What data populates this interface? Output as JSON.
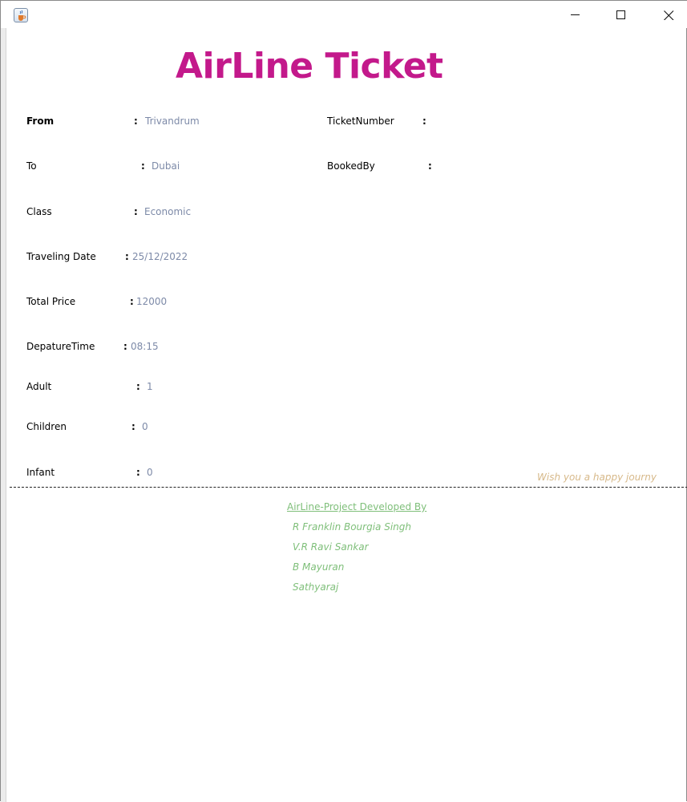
{
  "window": {
    "controls": {
      "minimize_icon": "minimize-icon",
      "maximize_icon": "maximize-icon",
      "close_icon": "close-icon"
    },
    "app_icon": "java-cup-icon"
  },
  "ticket": {
    "title": "AirLine Ticket",
    "colon": ":",
    "fields": {
      "from": {
        "label": "From",
        "value": "Trivandrum"
      },
      "to": {
        "label": "To",
        "value": "Dubai"
      },
      "class": {
        "label": "Class",
        "value": "Economic"
      },
      "traveling_date": {
        "label": "Traveling Date",
        "value": "25/12/2022"
      },
      "total_price": {
        "label": "Total Price",
        "value": "12000"
      },
      "departure_time": {
        "label": "DepatureTime",
        "value": "08:15"
      },
      "adult": {
        "label": "Adult",
        "value": "1"
      },
      "children": {
        "label": "Children",
        "value": "0"
      },
      "infant": {
        "label": "Infant",
        "value": "0"
      },
      "ticket_number": {
        "label": "TicketNumber",
        "value": ""
      },
      "booked_by": {
        "label": "BookedBy",
        "value": ""
      }
    },
    "wish": "Wish you a happy journy"
  },
  "credits": {
    "header": "AirLine-Project Developed By",
    "names": [
      "R Franklin Bourgia Singh",
      "V.R Ravi Sankar",
      "B Mayuran",
      "Sathyaraj"
    ]
  },
  "colors": {
    "title": "#c3198b",
    "value": "#7d8aa8",
    "wish": "#d7b98a",
    "credits": "#7fbf7a"
  }
}
